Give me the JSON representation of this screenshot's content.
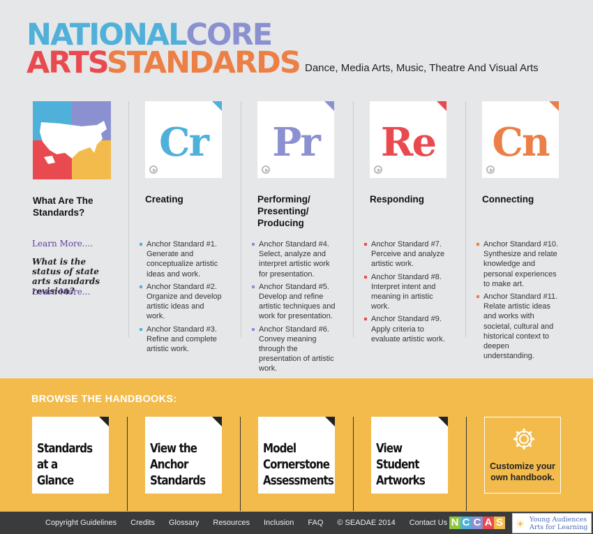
{
  "header": {
    "logo_line1_a": "NATIONAL",
    "logo_line1_b": "CORE",
    "logo_line2_a": "ARTS",
    "logo_line2_b": "STANDARDS",
    "tagline": "Dance, Media Arts, Music, Theatre And Visual Arts"
  },
  "intro": {
    "title": "What Are The Standards?",
    "learn_more_1": "Learn More....",
    "status_question": "What is the status of state arts standards revision?",
    "learn_more_2": "Learn More..."
  },
  "processes": [
    {
      "abbr": "Cr",
      "title": "Creating",
      "color": "#4fb0d9",
      "anchors": [
        "Anchor Standard #1. Generate and conceptualize artistic ideas and work.",
        "Anchor Standard #2. Organize and develop artistic ideas and work.",
        "Anchor Standard #3. Refine and complete artistic work."
      ]
    },
    {
      "abbr": "Pr",
      "title": "Performing/ Presenting/ Producing",
      "color": "#8a90d0",
      "anchors": [
        "Anchor Standard #4. Select, analyze and interpret artistic work for presentation.",
        "Anchor Standard #5. Develop and refine artistic techniques and work for presentation.",
        "Anchor Standard #6. Convey meaning through the presentation of artistic work."
      ]
    },
    {
      "abbr": "Re",
      "title": "Responding",
      "color": "#e84a4f",
      "anchors": [
        "Anchor Standard #7. Perceive and analyze artistic work.",
        "Anchor Standard #8. Interpret intent and meaning in artistic work.",
        "Anchor Standard #9. Apply criteria to evaluate artistic work."
      ]
    },
    {
      "abbr": "Cn",
      "title": "Connecting",
      "color": "#ec7f45",
      "anchors": [
        "Anchor Standard #10. Synthesize and relate knowledge and personal experiences to make art.",
        "Anchor Standard #11. Relate artistic ideas and works with societal, cultural and historical context to deepen understanding."
      ]
    }
  ],
  "handbooks": {
    "heading": "BROWSE THE HANDBOOKS:",
    "items": [
      "Standards at a Glance",
      "View the Anchor Standards",
      "Model Cornerstone Assessments",
      "View Student Artworks"
    ],
    "custom": "Customize your own handbook."
  },
  "footer": {
    "links": [
      "Copyright Guidelines",
      "Credits",
      "Glossary",
      "Resources",
      "Inclusion",
      "FAQ",
      "© SEADAE 2014",
      "Contact Us"
    ],
    "nccas": [
      "N",
      "C",
      "C",
      "A",
      "S"
    ],
    "partner_line1": "Young Audiences",
    "partner_line2": "Arts for Learning"
  },
  "colors": {
    "blue": "#4fb0d9",
    "purple": "#8a90d0",
    "red": "#e84a4f",
    "orange": "#ec7f45",
    "yellow": "#f2bb4c"
  }
}
